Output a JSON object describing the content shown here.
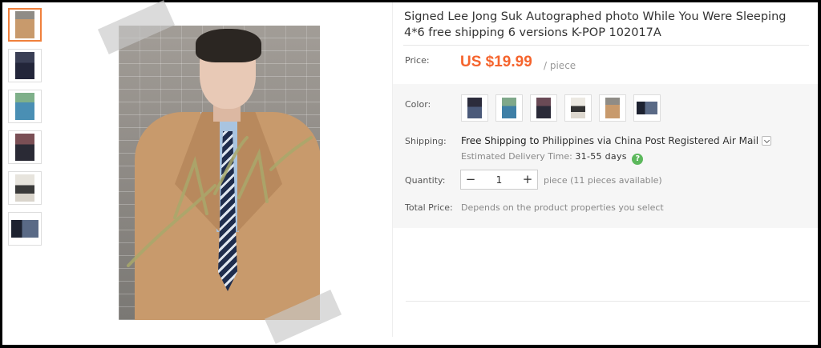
{
  "product": {
    "title": "Signed Lee Jong Suk Autographed photo While You Were Sleeping 4*6 free shipping 6 versions K-POP 102017A"
  },
  "price": {
    "label": "Price:",
    "value": "US $19.99",
    "unit": "/ piece",
    "color": "#f5642d"
  },
  "color_option": {
    "label": "Color:",
    "swatches": [
      "version-1",
      "version-2",
      "version-3",
      "version-4",
      "version-5",
      "version-6"
    ]
  },
  "shipping": {
    "label": "Shipping:",
    "method_prefix": "Free Shipping to",
    "destination": "Philippines",
    "via": "via China Post Registered Air Mail",
    "eta_label": "Estimated Delivery Time:",
    "eta_days": "31-55 days",
    "help_glyph": "?"
  },
  "quantity": {
    "label": "Quantity:",
    "minus": "−",
    "value": "1",
    "plus": "+",
    "note": "piece (11 pieces available)"
  },
  "total": {
    "label": "Total Price:",
    "value": "Depends on the product properties you select"
  },
  "thumbnails": {
    "count": 6,
    "selected_index": 0,
    "accent_color": "#f0803c"
  }
}
